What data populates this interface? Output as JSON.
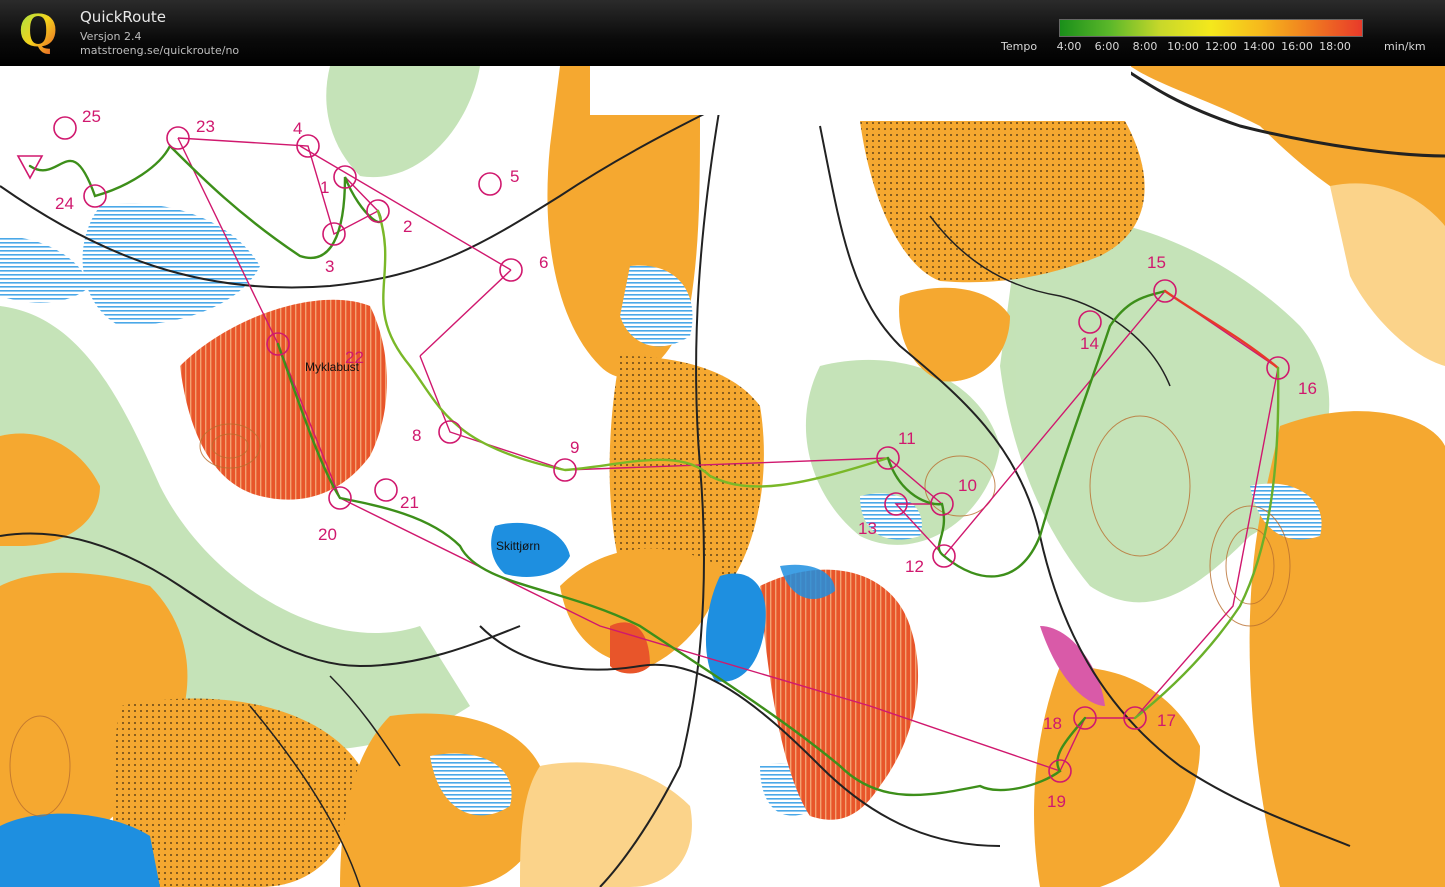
{
  "app": {
    "title": "QuickRoute",
    "version": "Versjon 2.4",
    "url": "matstroeng.se/quickroute/no",
    "logo_letter": "Q"
  },
  "pace_scale": {
    "label": "Tempo",
    "unit": "min/km",
    "ticks": [
      "4:00",
      "6:00",
      "8:00",
      "10:00",
      "12:00",
      "14:00",
      "16:00",
      "18:00"
    ],
    "gradient": [
      "#1a8f1a",
      "#5cb82a",
      "#c8d82a",
      "#f4e81c",
      "#f6b81c",
      "#f07a20",
      "#e83a2a"
    ]
  },
  "map": {
    "place_names": [
      "Myklabust",
      "Skittjørn"
    ],
    "controls": [
      "1",
      "2",
      "3",
      "4",
      "5",
      "6",
      "8",
      "9",
      "10",
      "11",
      "12",
      "13",
      "14",
      "15",
      "16",
      "17",
      "18",
      "19",
      "20",
      "21",
      "22",
      "23",
      "24",
      "25"
    ],
    "colors": {
      "open_land": "#f5a830",
      "forest": "#ffffff",
      "green": "#bfe0b0",
      "marsh": "#4aa8e8",
      "water": "#1e8fe0",
      "cultivated": "#e8552a",
      "course": "#d0186e",
      "route_green": "#3d8f1a"
    }
  }
}
